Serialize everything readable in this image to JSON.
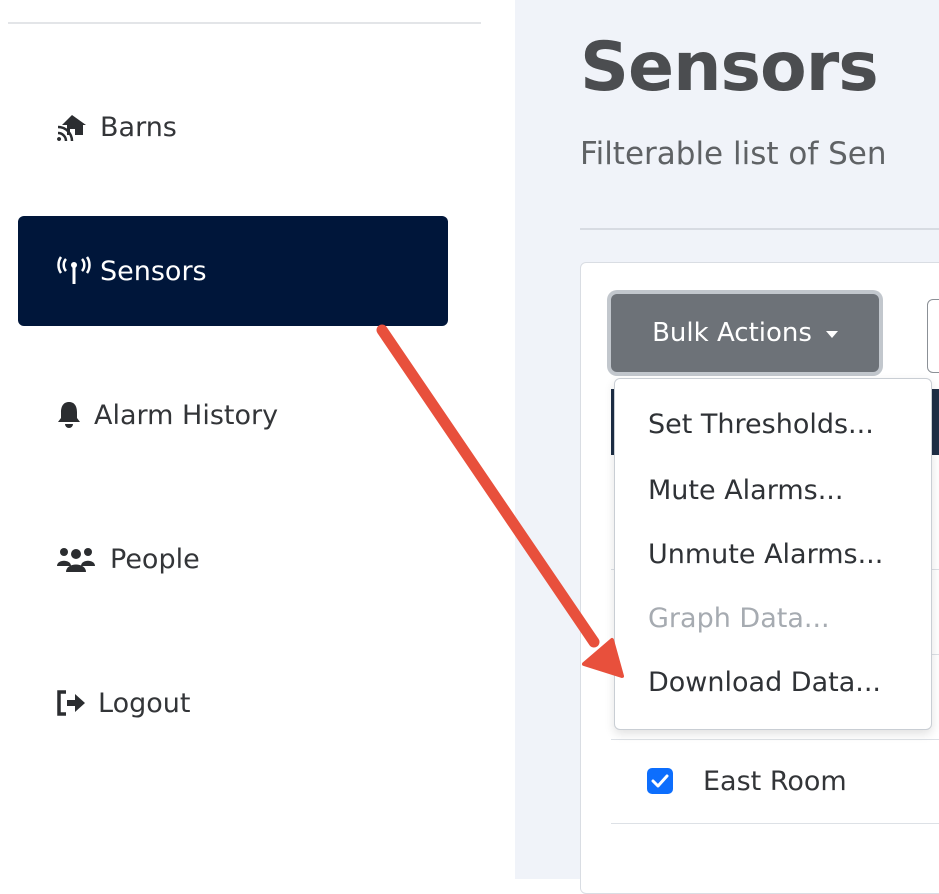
{
  "sidebar": {
    "items": [
      {
        "label": "Barns",
        "icon": "barn-wifi-icon",
        "active": false
      },
      {
        "label": "Sensors",
        "icon": "antenna-icon",
        "active": true
      },
      {
        "label": "Alarm History",
        "icon": "bell-icon",
        "active": false
      },
      {
        "label": "People",
        "icon": "people-icon",
        "active": false
      },
      {
        "label": "Logout",
        "icon": "logout-icon",
        "active": false
      }
    ]
  },
  "main": {
    "title": "Sensors",
    "subtitle": "Filterable list of Sen",
    "bulk_actions_label": "Bulk Actions",
    "row": {
      "label": "East Room",
      "checked": true
    }
  },
  "dropdown": {
    "items": [
      {
        "label": "Set Thresholds...",
        "disabled": false
      },
      {
        "label": "Mute Alarms...",
        "disabled": false
      },
      {
        "label": "Unmute Alarms...",
        "disabled": false
      },
      {
        "label": "Graph Data...",
        "disabled": true
      },
      {
        "label": "Download Data...",
        "disabled": false
      }
    ]
  },
  "colors": {
    "sidebar_active_bg": "#00163a",
    "bulk_button_bg": "#6d7278",
    "checkbox": "#0d6efd",
    "annotation_arrow": "#e8503c"
  }
}
